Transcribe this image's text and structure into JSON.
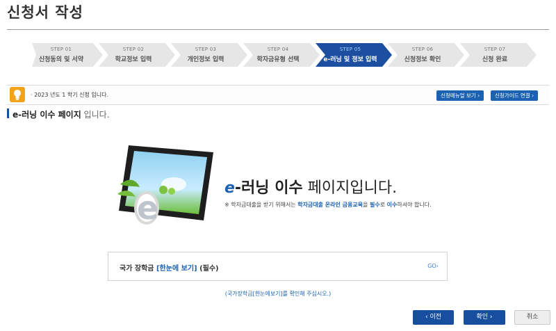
{
  "page": {
    "title": "신청서 작성"
  },
  "steps": [
    {
      "num": "STEP 01",
      "label": "신청동의 및 서약"
    },
    {
      "num": "STEP 02",
      "label": "학교정보 입력"
    },
    {
      "num": "STEP 03",
      "label": "개인정보 입력"
    },
    {
      "num": "STEP 04",
      "label": "학자금유형 선택"
    },
    {
      "num": "STEP 05",
      "label": "e-러닝 및 정보 입력"
    },
    {
      "num": "STEP 06",
      "label": "신청정보 확인"
    },
    {
      "num": "STEP 07",
      "label": "신청 완료"
    }
  ],
  "notice": {
    "text": "· 2023 년도 1 학기 신청 입니다.",
    "manual_button": "신청매뉴얼 보기 ›",
    "guide_button": "신청가이드 연결 ›"
  },
  "section": {
    "strong": "e-러닝 이수 페이지",
    "rest": " 입니다."
  },
  "hero": {
    "title_e": "e",
    "title_bold": "-러닝 이수",
    "title_rest": " 페이지입니다.",
    "sub_1": "※ 학자금대출을 받기 위해서는 ",
    "sub_2": "학자금대출 온라인 금융교육",
    "sub_3": "을 ",
    "sub_4": "필수",
    "sub_5": "로 ",
    "sub_6": "이수",
    "sub_7": "하셔야 합니다."
  },
  "scholarship": {
    "prefix": "국가 장학금 ",
    "link": "[한눈에 보기]",
    "suffix": " (필수)",
    "go": "GO›"
  },
  "hint": "(국가장학금[한눈에보기]를 확인해 주십시오.)",
  "buttons": {
    "prev": "‹  이전",
    "confirm": "확인  ›",
    "cancel": "취소"
  },
  "colors": {
    "accent": "#1c62b3",
    "active_step": "#1c4fa0",
    "inactive_step": "#e6e6e6"
  }
}
